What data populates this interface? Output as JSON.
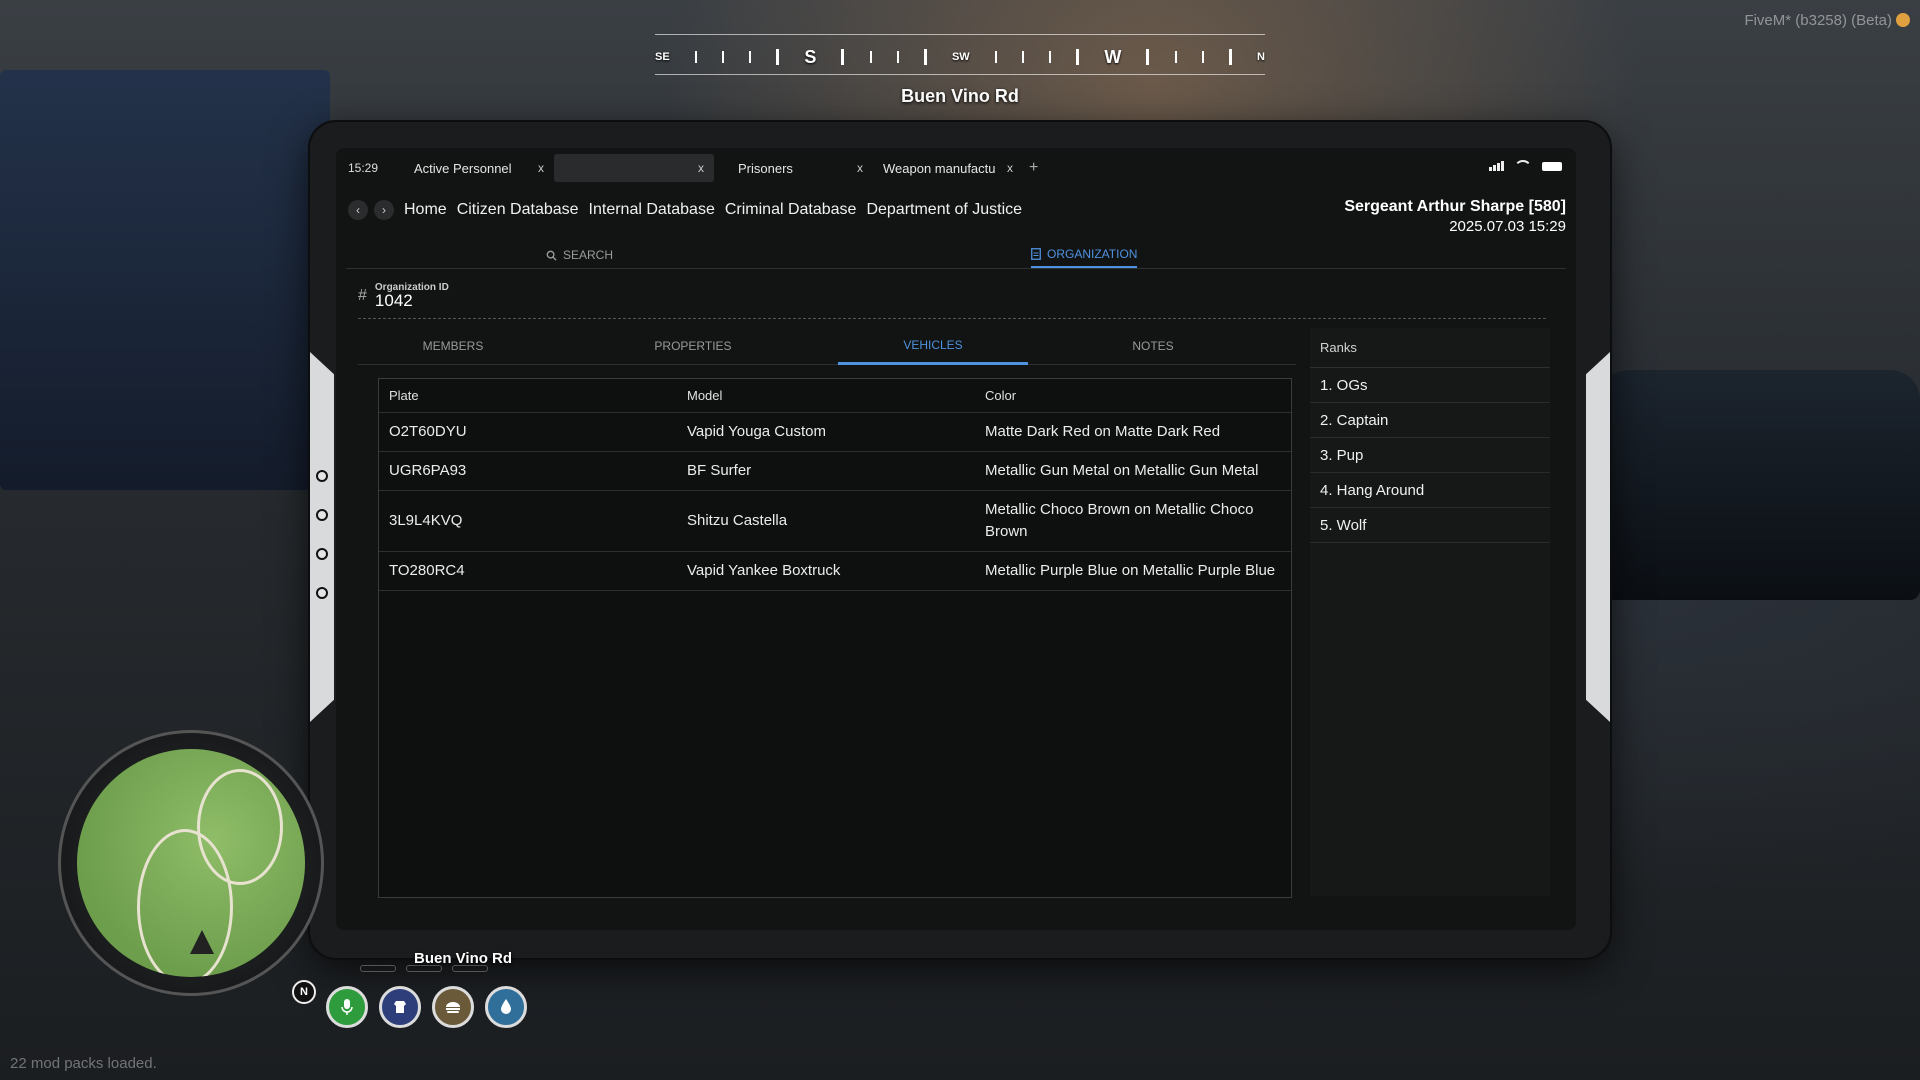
{
  "compass": {
    "points": [
      "SE",
      "S",
      "SW",
      "W",
      "N"
    ],
    "street": "Buen Vino Rd"
  },
  "fivem_label": "FiveM* (b3258) (Beta)",
  "modpacks": "22 mod packs loaded.",
  "tablet": {
    "clock": "15:29",
    "tabs": [
      {
        "label": "Active Personnel",
        "close": "x"
      },
      {
        "label": "",
        "close": "x"
      },
      {
        "label": "Prisoners",
        "close": "x"
      },
      {
        "label": "Weapon manufactu",
        "close": "x"
      }
    ],
    "add_tab": "+",
    "nav": {
      "back": "‹",
      "forward": "›",
      "links": [
        "Home",
        "Citizen Database",
        "Internal Database",
        "Criminal Database",
        "Department of Justice"
      ]
    },
    "officer": {
      "name": "Sergeant Arthur Sharpe [580]",
      "datetime": "2025.07.03 15:29"
    },
    "sections": {
      "search": "SEARCH",
      "organization": "ORGANIZATION"
    },
    "org": {
      "id_label": "Organization ID",
      "id_value": "1042"
    },
    "subtabs": [
      "MEMBERS",
      "PROPERTIES",
      "VEHICLES",
      "NOTES"
    ],
    "active_subtab": "VEHICLES",
    "vehicles": {
      "headers": [
        "Plate",
        "Model",
        "Color"
      ],
      "rows": [
        {
          "plate": "O2T60DYU",
          "model": "Vapid Yougа Custom",
          "color": "Matte Dark Red on Matte Dark Red"
        },
        {
          "plate": "UGR6PA93",
          "model": "BF Surfer",
          "color": "Metallic Gun Metal on Metallic Gun Metal"
        },
        {
          "plate": "3L9L4KVQ",
          "model": "Shitzu Castella",
          "color": "Metallic Choco Brown on Metallic Choco Brown"
        },
        {
          "plate": "TO280RC4",
          "model": "Vapid Yankee Boxtruck",
          "color": "Metallic Purple Blue on Metallic Purple Blue"
        }
      ]
    },
    "ranks": {
      "title": "Ranks",
      "items": [
        "1. OGs",
        "2. Captain",
        "3. Pup",
        "4. Hang Around",
        "5. Wolf"
      ]
    }
  },
  "hud": {
    "street": "Buen Vino Rd",
    "north": "N",
    "icons": [
      "microphone-icon",
      "armor-icon",
      "hunger-icon",
      "thirst-icon"
    ],
    "icon_colors": [
      "#2e9c3c",
      "#2d3e7a",
      "#6a5a3a",
      "#2f6f9a"
    ]
  }
}
